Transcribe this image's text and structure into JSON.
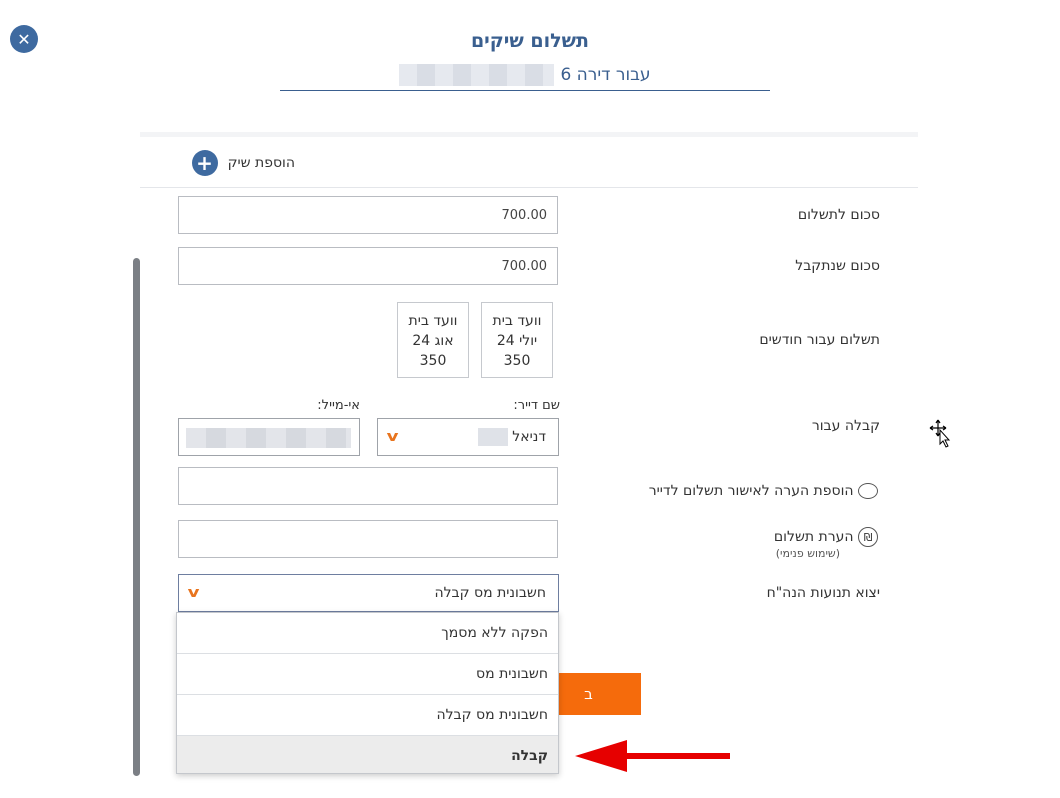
{
  "header": {
    "title": "תשלום שיקים",
    "subtitle": "עבור דירה 6"
  },
  "add_check": {
    "label": "הוספת שיק",
    "icon": "plus-icon"
  },
  "form": {
    "amount_to_pay": {
      "label": "סכום לתשלום",
      "value": "700.00"
    },
    "amount_received": {
      "label": "סכום שנתקבל",
      "value": "700.00"
    },
    "months": {
      "label": "תשלום עבור חודשים",
      "items": [
        {
          "type": "וועד בית",
          "month": "יולי 24",
          "amount": "350"
        },
        {
          "type": "וועד בית",
          "month": "אוג 24",
          "amount": "350"
        }
      ]
    },
    "receipt_for": {
      "label": "קבלה עבור",
      "tenant_label": "שם דייר:",
      "tenant_value": "דניאל",
      "email_label": "אי-מייל:"
    },
    "tenant_note": {
      "label": "הוספת הערה לאישור תשלום לדייר",
      "icon": "speech-bubble-icon",
      "value": ""
    },
    "payment_note": {
      "label": "הערת תשלום",
      "sub": "(שימוש פנימי)",
      "icon": "shekel-icon",
      "value": ""
    },
    "export": {
      "label": "יצוא תנועות הנה\"ח",
      "selected": "חשבונית מס קבלה",
      "options": [
        "הפקה ללא מסמך",
        "חשבונית מס",
        "חשבונית מס קבלה",
        "קבלה"
      ],
      "highlighted": "קבלה"
    }
  },
  "submit": {
    "label": "ב"
  },
  "colors": {
    "accent": "#3e6aa0",
    "orange": "#f56b0c",
    "arrow": "#e60000"
  }
}
